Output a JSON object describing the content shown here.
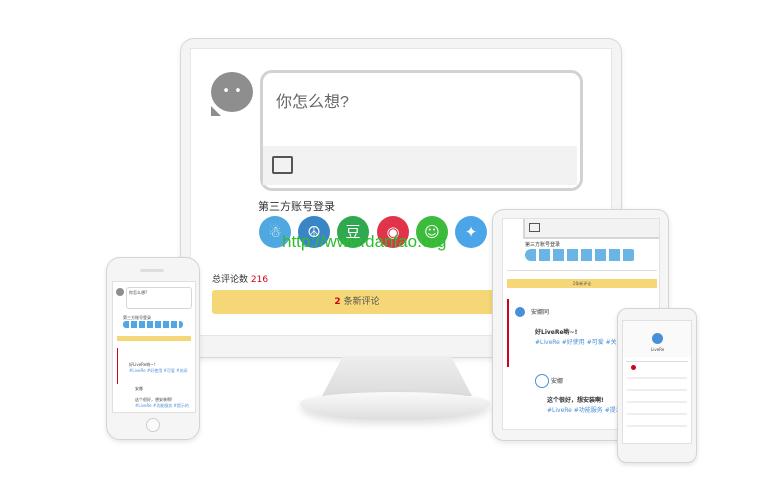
{
  "main": {
    "placeholder": "你怎么想?",
    "social_title": "第三方账号登录",
    "social_icons": [
      {
        "name": "qq-icon",
        "color": "#4fa8e0",
        "glyph": "☃"
      },
      {
        "name": "renren-icon",
        "color": "#3a85c6",
        "glyph": "☮"
      },
      {
        "name": "douban-icon",
        "color": "#2fa84f",
        "glyph": "豆"
      },
      {
        "name": "weibo-icon",
        "color": "#e0344a",
        "glyph": "◉"
      },
      {
        "name": "wechat-icon",
        "color": "#3cbb3c",
        "glyph": "☺"
      },
      {
        "name": "twitter-icon",
        "color": "#4aa6e8",
        "glyph": "✦"
      }
    ],
    "total_label": "总评论数",
    "total_count": "216",
    "new_comments_count": "2",
    "new_comments_label": "条新评论",
    "watermark": "http://www.danfao.org"
  },
  "tablet": {
    "social_title": "第三方账号登录",
    "new_bar": "2条新评论",
    "user1": "安娜同",
    "comment1": "好LiveRe哟~!",
    "tags1": "#LiveRe #好使用 #可爱 #关闭",
    "user2": "安娜",
    "comment2": "这个很好，想安装啊!",
    "tags2": "#LiveRe #功能服务 #提示的"
  },
  "phone_left": {
    "placeholder": "你怎么想?",
    "social_title": "第三方账号登录",
    "comment1": "好LiveRe哟~!",
    "tags1": "#LiveRe #好使用 #可爱 #关闭",
    "user2": "安娜",
    "comment2": "这个很好，想安装啊!",
    "tags2": "#LiveRe #功能服务 #提示的"
  },
  "phone_right": {
    "title": "LiveRe"
  },
  "colors": {
    "accent_yellow": "#f6d778",
    "count_red": "#d0021b",
    "hashtag_blue": "#4a90d9"
  }
}
